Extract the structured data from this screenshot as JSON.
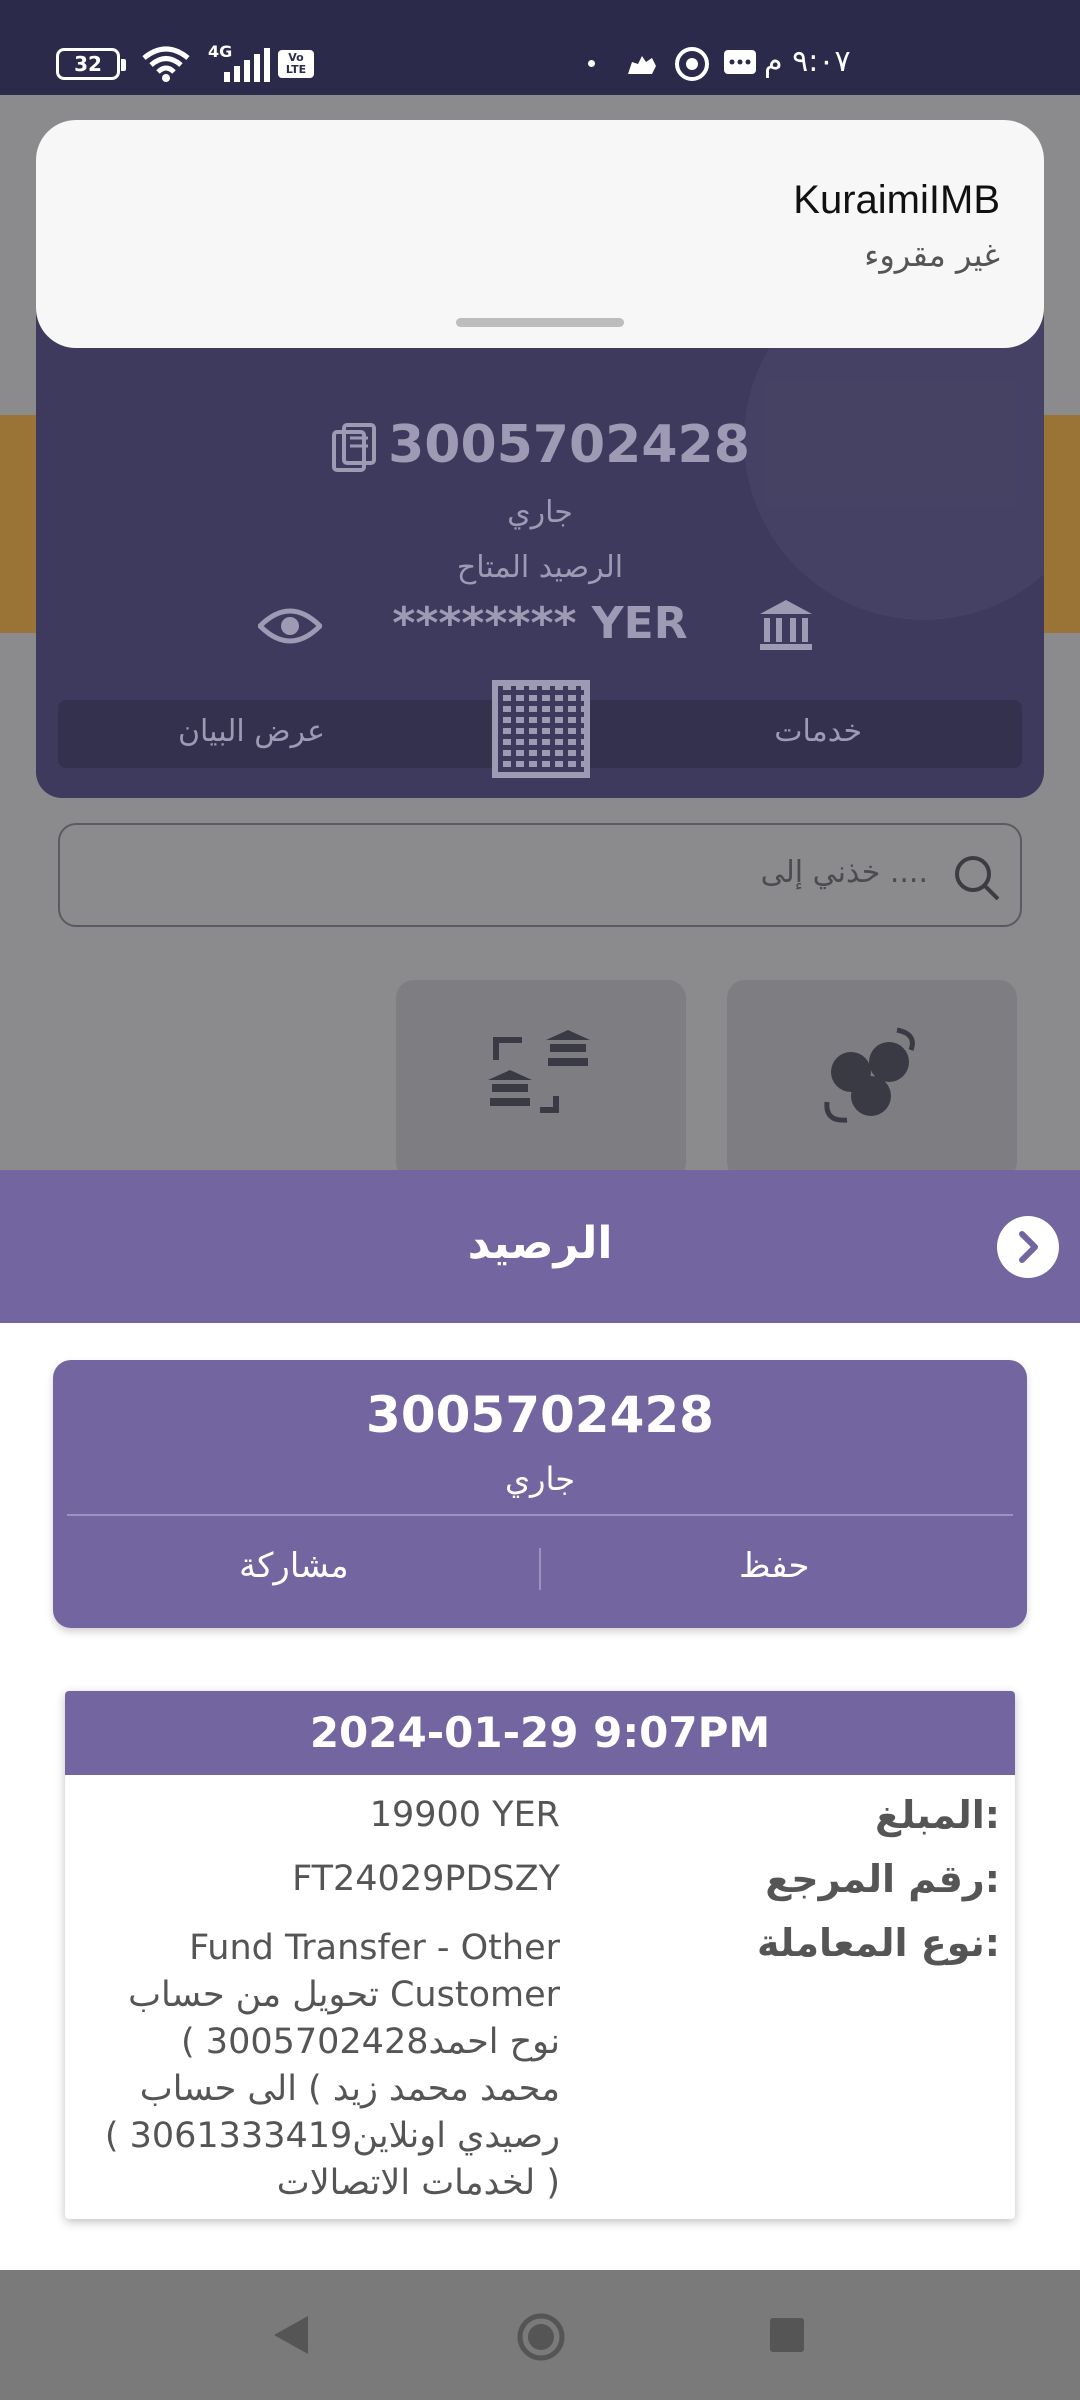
{
  "status_bar": {
    "battery": "32",
    "network": "4G",
    "volte": "Vo LTE",
    "time": "٩:٠٧ م"
  },
  "notification": {
    "app_name": "KuraimiIMB",
    "text": "غير مقروء"
  },
  "background": {
    "account_number": "3005702428",
    "account_type": "جاري",
    "available_label": "الرصيد المتاح",
    "masked_balance": "******** YER",
    "statement_button": "عرض البيان",
    "services_button": "خدمات",
    "search_placeholder": "خذني إلى ...."
  },
  "sheet": {
    "title": "الرصيد",
    "account_number": "3005702428",
    "account_type": "جاري",
    "share_button": "مشاركة",
    "save_button": "حفظ"
  },
  "transaction": {
    "datetime": "2024-01-29 9:07PM",
    "amount_label": "المبلغ:",
    "amount_value": "19900 YER",
    "reference_label": "رقم المرجع:",
    "reference_value": "FT24029PDSZY",
    "type_label": "نوع المعاملة:",
    "type_value_lines": [
      "Fund Transfer - Other",
      "تحويل من حساب Customer",
      "( نوح احمد3005702428",
      "محمد محمد زيد ) الى حساب",
      "( رصيدي اونلاين3061333419",
      "لخدمات الاتصالات )"
    ]
  },
  "colors": {
    "brand_purple": "#7265a0",
    "status_bar": "#2b2a4a"
  },
  "icons": [
    "wifi-icon",
    "signal-icon",
    "whatsapp-icon",
    "message-icon",
    "camel-icon",
    "document-icon",
    "eye-icon",
    "bank-icon",
    "qr-icon",
    "search-icon",
    "chevron-right-icon",
    "back-icon",
    "home-icon",
    "recent-apps-icon"
  ]
}
